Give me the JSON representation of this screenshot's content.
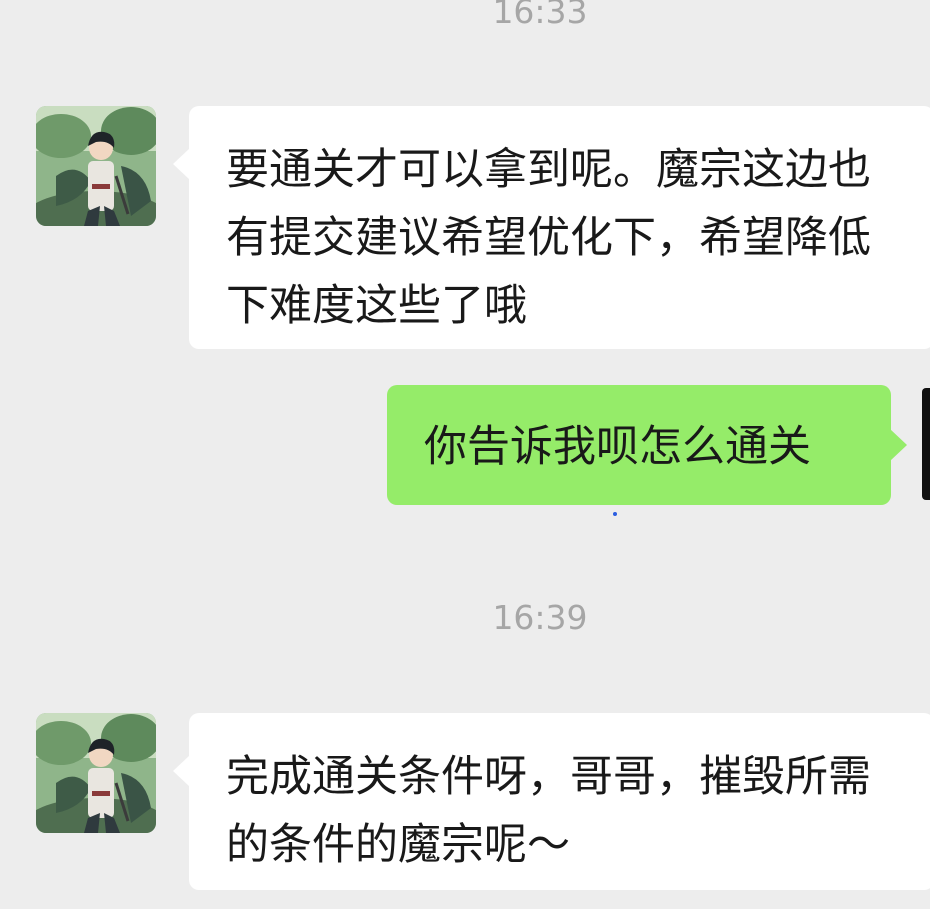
{
  "timestamps": [
    "16:33",
    "16:39"
  ],
  "messages": [
    {
      "direction": "incoming",
      "sender_avatar": "avatar-anime-swordsman",
      "text": "要通关才可以拿到呢。魔宗这边也有提交建议希望优化下，希望降低下难度这些了哦"
    },
    {
      "direction": "outgoing",
      "text": "你告诉我呗怎么通关"
    },
    {
      "direction": "incoming",
      "sender_avatar": "avatar-anime-swordsman",
      "text": "完成通关条件呀，哥哥，摧毁所需的条件的魔宗呢～"
    }
  ],
  "colors": {
    "background": "#ededed",
    "incoming_bubble": "#ffffff",
    "outgoing_bubble": "#95ec69",
    "timestamp_text": "#a6a6a6",
    "message_text": "#191919"
  }
}
